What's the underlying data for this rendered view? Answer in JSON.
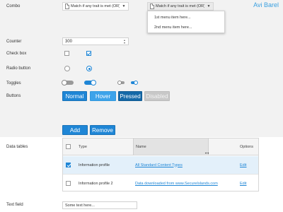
{
  "author": "Avi Barel",
  "labels": {
    "combo": "Combo",
    "counter": "Counter",
    "checkbox": "Check box",
    "radio": "Radio button",
    "toggles": "Toggles",
    "buttons": "Buttons",
    "data_tables": "Data tables",
    "text_field": "Text field"
  },
  "combo": {
    "closed_value": "Match if any trait is met (OR)",
    "open_value": "Match if any trait is met (OR)",
    "menu_items": [
      "1st menu item here...",
      "2nd menu item here..."
    ],
    "arrow_glyph": "▼"
  },
  "counter": {
    "value": "300",
    "up_glyph": "▲",
    "down_glyph": "▼"
  },
  "buttons": {
    "normal": "Normal",
    "hover": "Hover",
    "pressed": "Pressed",
    "disabled": "Disabled"
  },
  "table_actions": {
    "add": "Add",
    "remove": "Remove"
  },
  "table": {
    "headers": {
      "type": "Type",
      "name": "Name",
      "options": "Options"
    },
    "rows": [
      {
        "selected": true,
        "type": "Information profile",
        "name": "All Standard Content Types",
        "option": "Edit"
      },
      {
        "selected": false,
        "type": "Information profile 2",
        "name": "Data downloaded from www.SecureIslands.com",
        "option": "Edit"
      }
    ]
  },
  "text_field": {
    "value": "Some text here..."
  },
  "colors": {
    "accent": "#1f86d6",
    "hover": "#3da3ea",
    "pressed": "#1569a8",
    "disabled": "#c8c8c8",
    "background_top": "#f2f2f2",
    "author_text": "#3aa0e0"
  },
  "states": {
    "checkbox_unchecked": false,
    "checkbox_checked": true,
    "radio_unselected": false,
    "radio_selected": true,
    "toggle_1_on": false,
    "toggle_2_on": true,
    "toggle_3_on": false,
    "toggle_4_on": true
  }
}
